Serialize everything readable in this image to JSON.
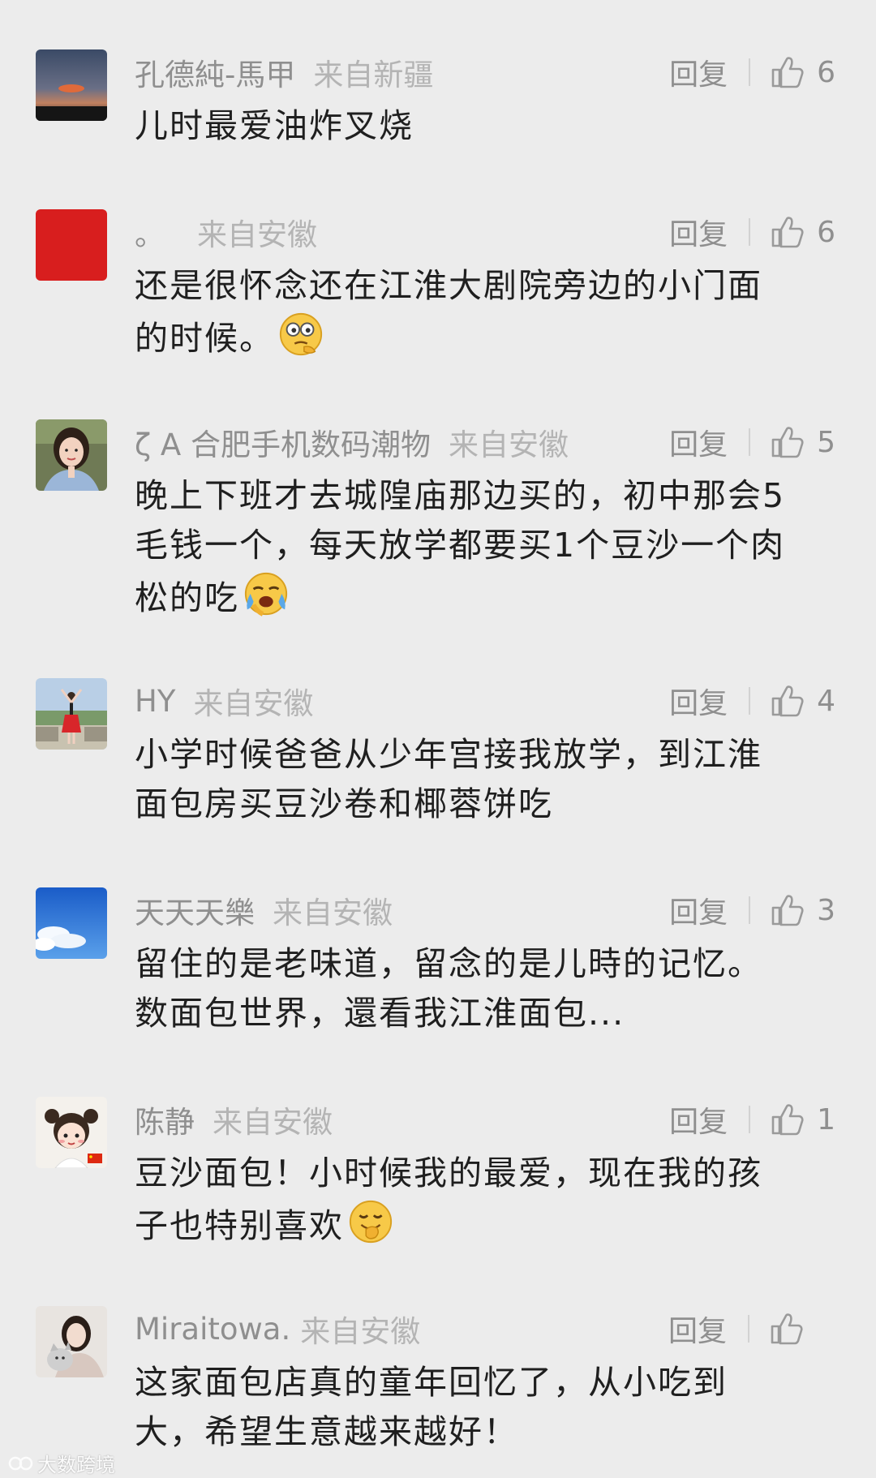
{
  "reply_label": "回复",
  "colors": {
    "background": "#ececec",
    "username": "#8f8f8f",
    "location": "#b4b4b4",
    "text": "#1f1f1f"
  },
  "comments": [
    {
      "username": "孔德純-馬甲",
      "location": "来自新疆",
      "likes": "6",
      "lines": [
        "儿时最爱油炸叉烧"
      ],
      "avatar": "sunset-photo",
      "emoji": ""
    },
    {
      "username": "。",
      "location": "来自安徽",
      "likes": "6",
      "lines": [
        "还是很怀念还在江淮大剧院旁边的小门面",
        "的时候。"
      ],
      "avatar": "red-square",
      "emoji": "thinking-face-emoji"
    },
    {
      "username": "ζ A 合肥手机数码潮物",
      "location": "来自安徽",
      "likes": "5",
      "lines": [
        "晚上下班才去城隍庙那边买的，初中那会5",
        "毛钱一个，每天放学都要买1个豆沙一个肉",
        "松的吃"
      ],
      "avatar": "girl-portrait",
      "emoji": "crying-face-emoji"
    },
    {
      "username": "HY",
      "location": "来自安徽",
      "likes": "4",
      "lines": [
        "小学时候爸爸从少年宫接我放学，到江淮",
        "面包房买豆沙卷和椰蓉饼吃"
      ],
      "avatar": "dancer-photo",
      "emoji": ""
    },
    {
      "username": "天天天樂",
      "location": "来自安徽",
      "likes": "3",
      "lines": [
        "留住的是老味道，留念的是儿時的记忆。",
        "数面包世界，還看我江淮面包..."
      ],
      "avatar": "blue-sky",
      "emoji": ""
    },
    {
      "username": "陈静",
      "location": "来自安徽",
      "likes": "1",
      "lines": [
        "豆沙面包！小时候我的最爱，现在我的孩",
        "子也特别喜欢"
      ],
      "avatar": "cartoon-girl",
      "emoji": "giggle-face-emoji"
    },
    {
      "username": "Miraitowa.",
      "location": "来自安徽",
      "likes": "",
      "lines": [
        "这家面包店真的童年回忆了，从小吃到",
        "大，希望生意越来越好！"
      ],
      "avatar": "woman-cat-photo",
      "emoji": ""
    }
  ],
  "watermark": {
    "text": "大数跨境"
  }
}
